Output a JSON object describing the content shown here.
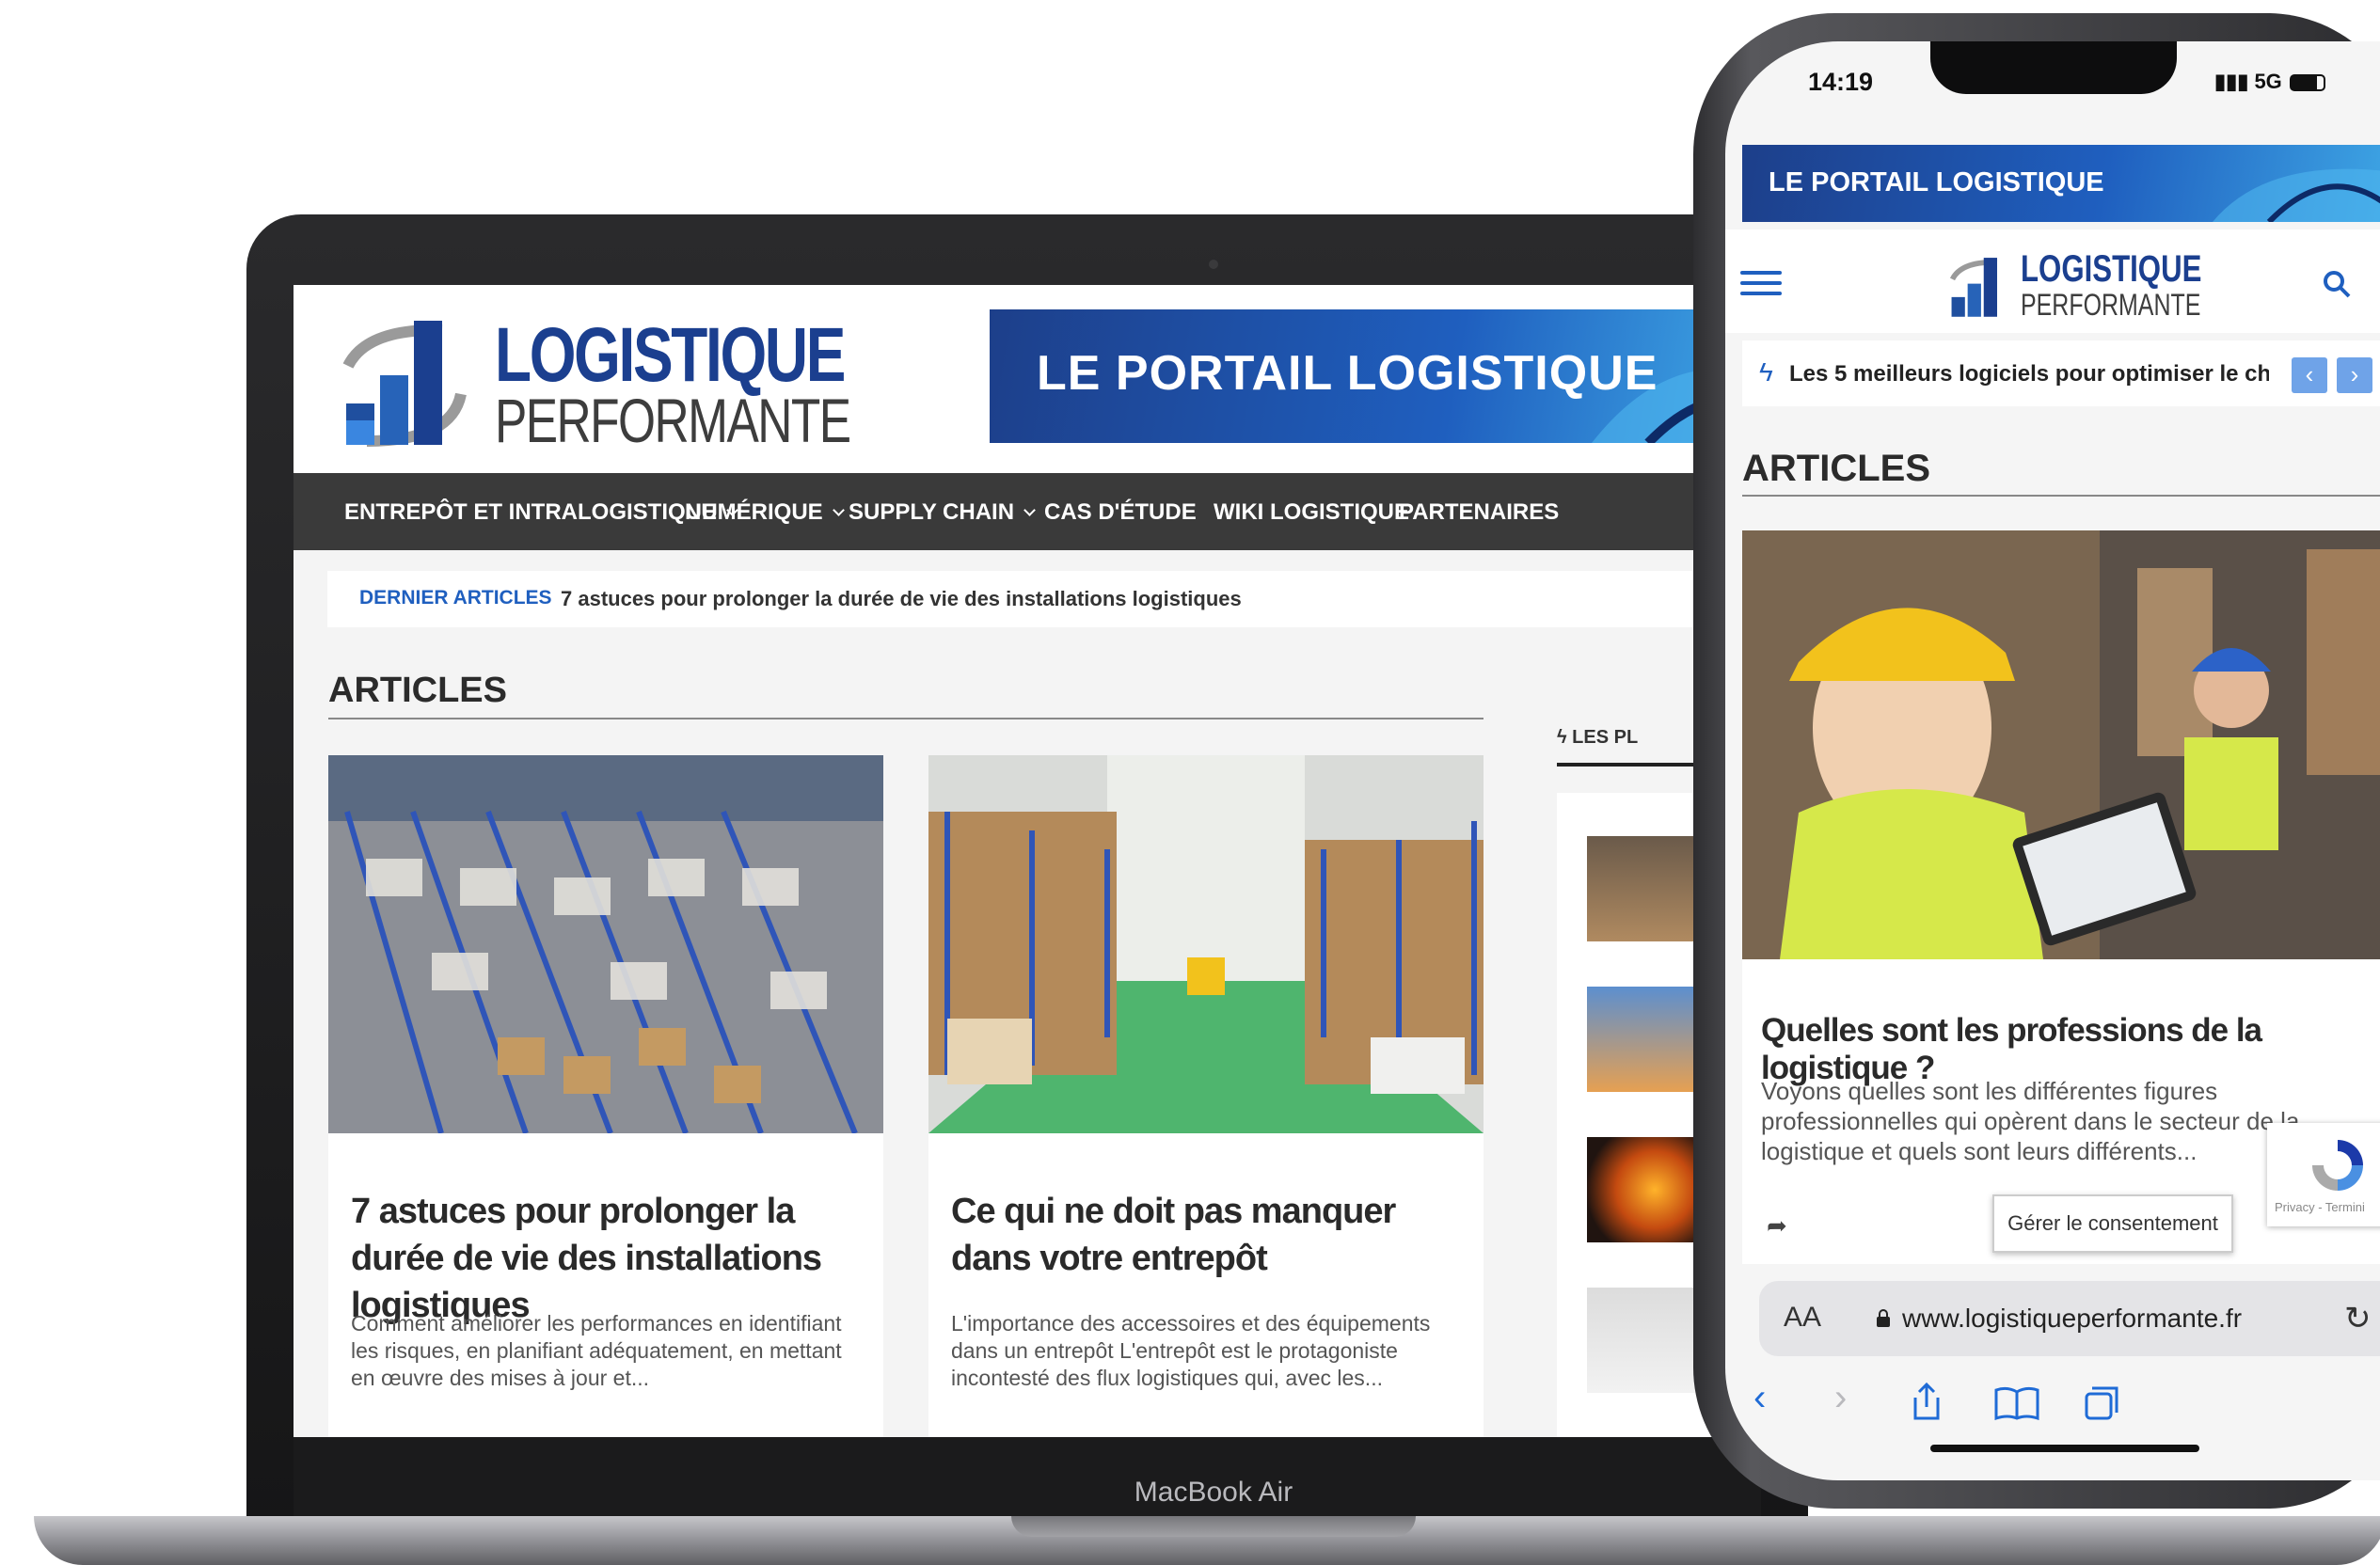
{
  "laptop": {
    "brand": "MacBook Air",
    "site": {
      "logo": {
        "line1": "LOGISTIQUE",
        "line2": "PERFORMANTE"
      },
      "banner_text": "LE PORTAIL LOGISTIQUE",
      "nav": [
        {
          "label": "ENTREPÔT ET INTRALOGISTIQUE",
          "has_dropdown": true
        },
        {
          "label": "NUMÉRIQUE",
          "has_dropdown": true
        },
        {
          "label": "SUPPLY CHAIN",
          "has_dropdown": true
        },
        {
          "label": "CAS D'ÉTUDE",
          "has_dropdown": false
        },
        {
          "label": "WIKI LOGISTIQUE",
          "has_dropdown": false
        },
        {
          "label": "PARTENAIRES",
          "has_dropdown": false
        }
      ],
      "ticker": {
        "label": "DERNIER ARTICLES",
        "text": "7 astuces pour prolonger la durée de vie des installations logistiques"
      },
      "section_title": "ARTICLES",
      "articles": [
        {
          "title": "7 astuces pour prolonger la durée de vie des installations logistiques",
          "excerpt": "Comment améliorer les performances en identifiant les risques, en planifiant adéquatement, en mettant en œuvre des mises à jour et..."
        },
        {
          "title": "Ce qui ne doit pas manquer dans votre entrepôt",
          "excerpt": "L'importance des accessoires et des équipements dans un entrepôt L'entrepôt est le protagoniste incontesté des flux logistiques qui, avec les..."
        }
      ],
      "sidebar_tab": "LES PL"
    }
  },
  "phone": {
    "status": {
      "time": "14:19",
      "network": "5G"
    },
    "banner_text": "LE PORTAIL LOGISTIQUE",
    "logo": {
      "line1": "LOGISTIQUE",
      "line2": "PERFORMANTE"
    },
    "ticker_text": "Les 5 meilleurs logiciels pour optimiser le ch",
    "section_title": "ARTICLES",
    "article": {
      "title": "Quelles sont les professions de la logistique ?",
      "excerpt": "Voyons quelles sont les différentes figures professionnelles qui opèrent dans le secteur de la logistique et quels sont leurs différents..."
    },
    "consent_button": "Gérer le consentement",
    "recaptcha_text": "Privacy - Termini",
    "urlbar": {
      "aa": "AA",
      "url": "www.logistiqueperformante.fr"
    }
  },
  "colors": {
    "brand_blue": "#1b3f8f",
    "accent_blue": "#1f5fbf",
    "nav_bg": "#3a3a3a"
  }
}
